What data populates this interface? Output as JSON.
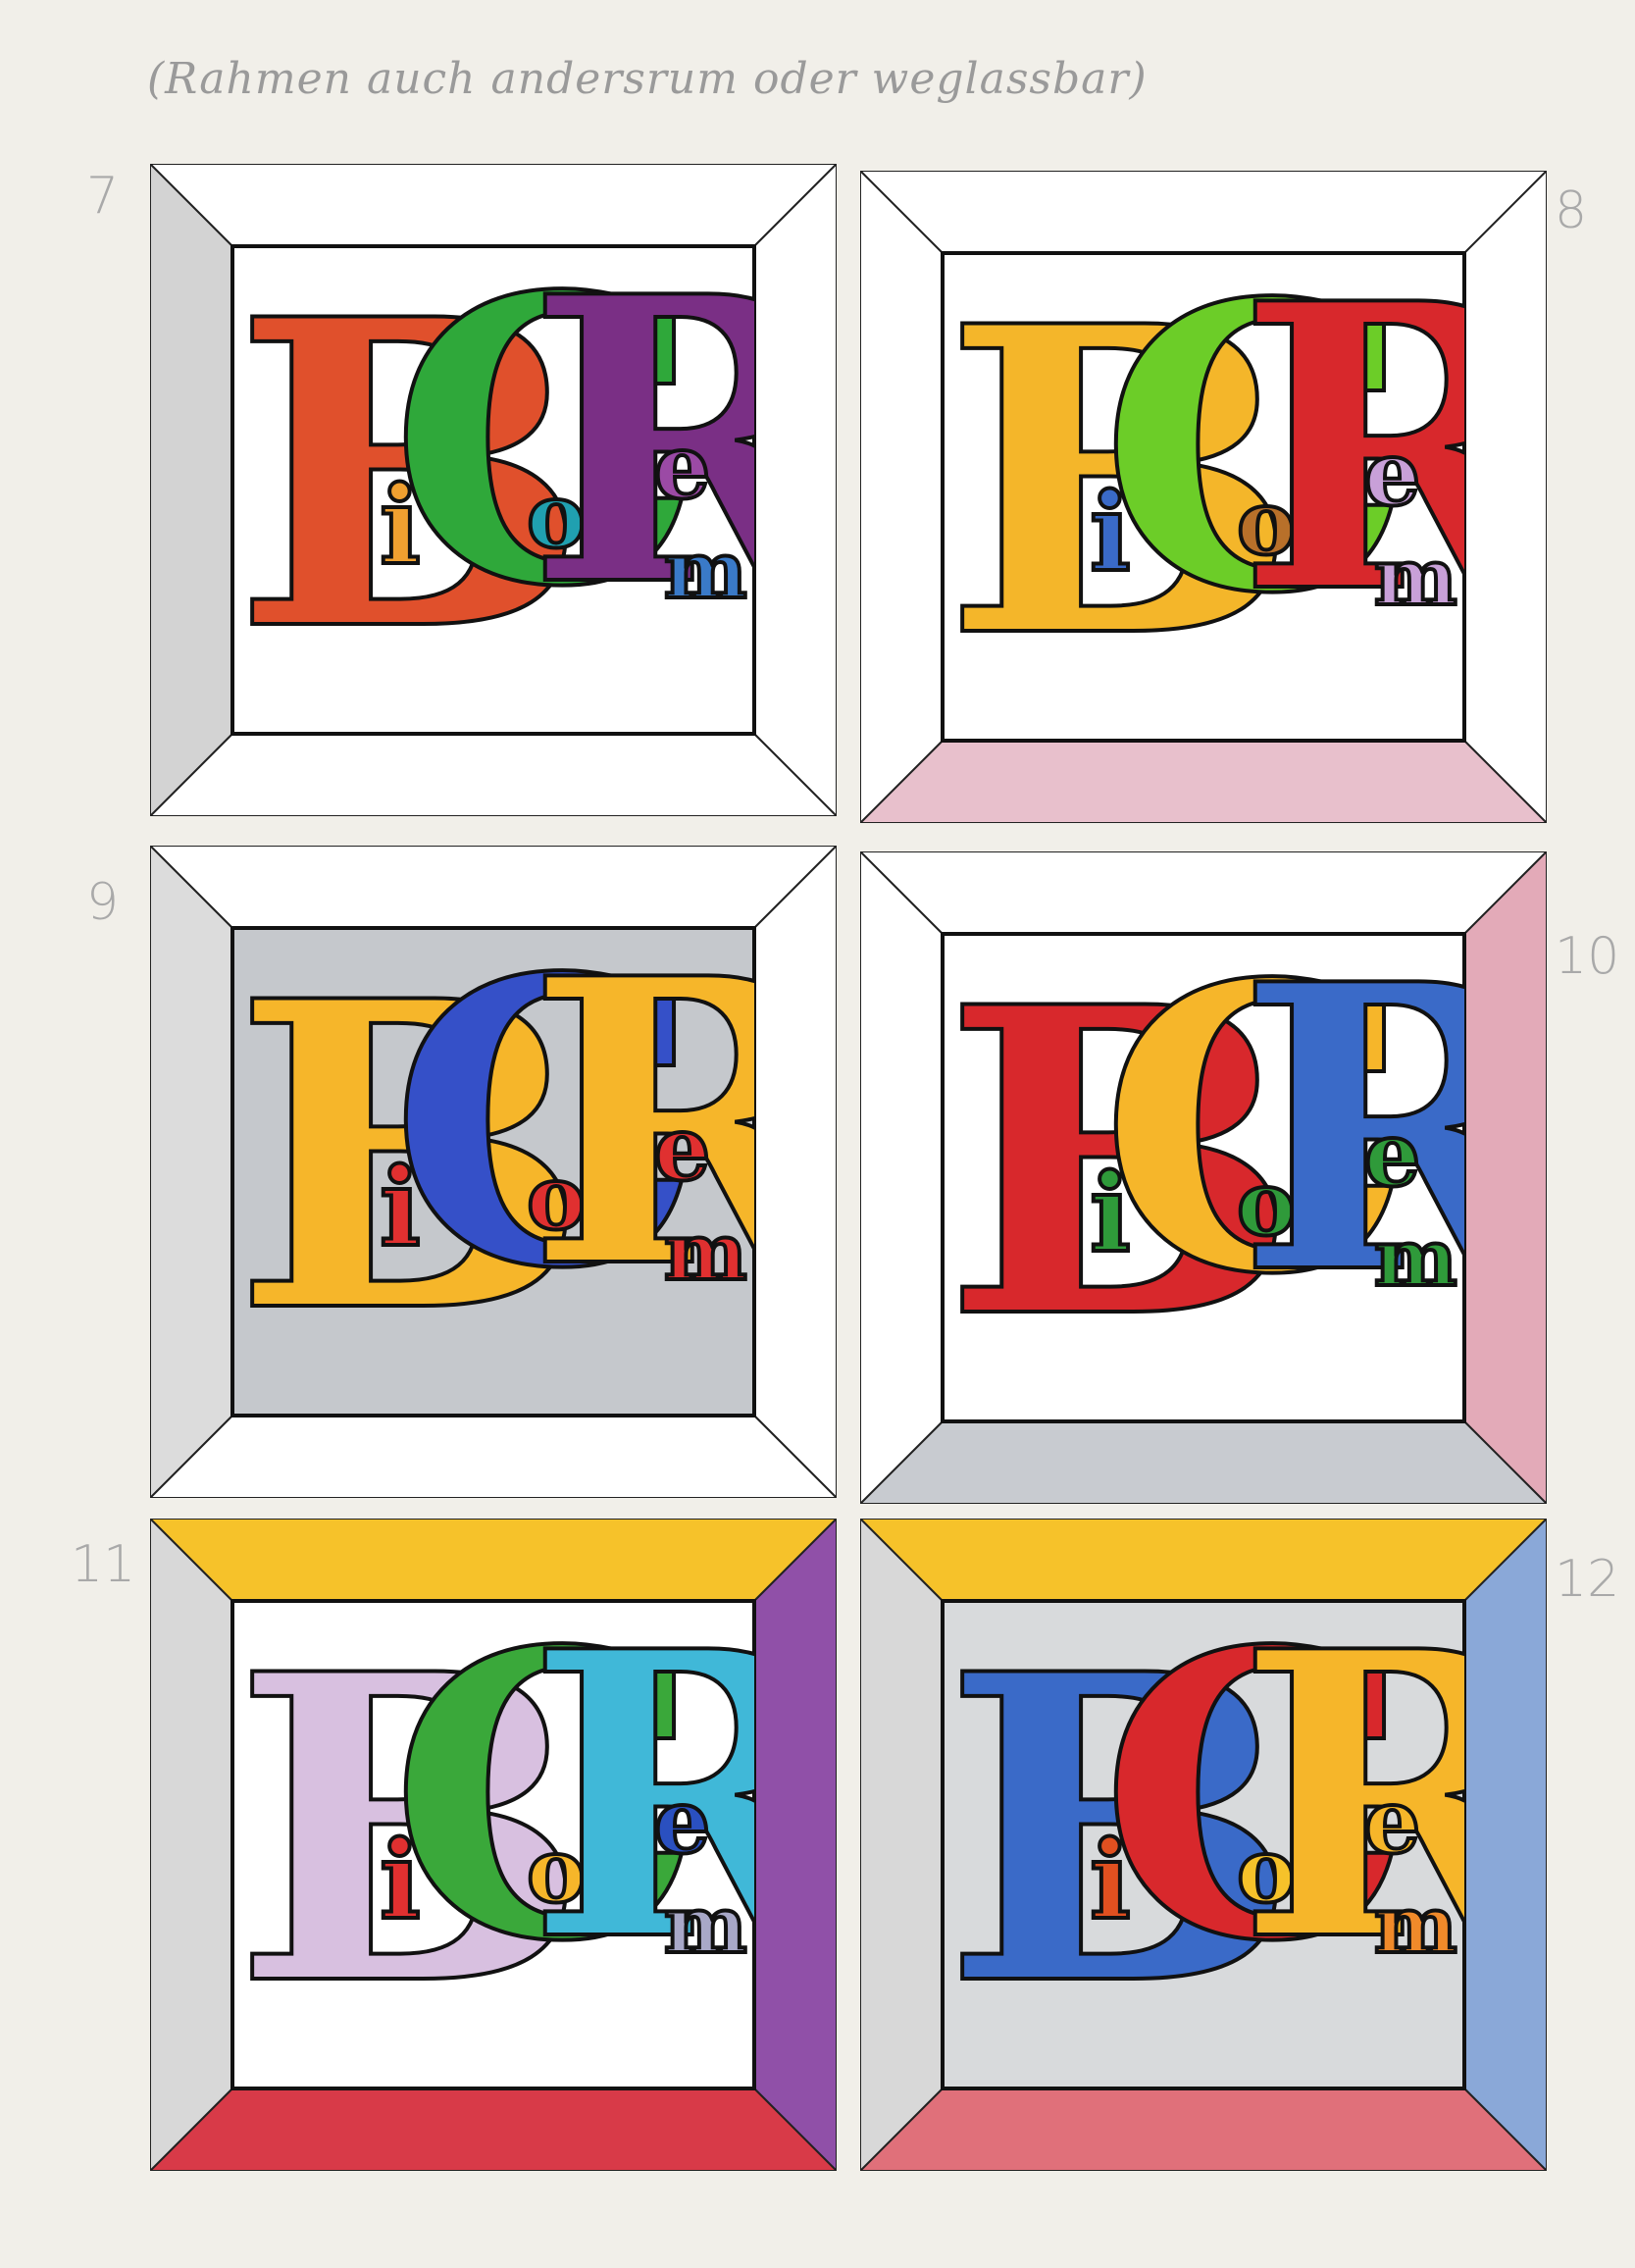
{
  "note": "(Rahmen auch andersrum oder weglassbar)",
  "panels": [
    {
      "number": "7",
      "inner_bg": "#ffffff",
      "bevels": {
        "top": "#ffffff",
        "right": "#ffffff",
        "bottom": "#ffffff",
        "left": "#d3d3d3"
      },
      "letters": [
        {
          "char": "B",
          "color": "#e0502c"
        },
        {
          "char": "i",
          "color": "#f0a030"
        },
        {
          "char": "C",
          "color": "#2fa83a"
        },
        {
          "char": "o",
          "color": "#20a0b0"
        },
        {
          "char": "R",
          "color": "#7a2f85"
        },
        {
          "char": "e",
          "color": "#9b4aa5"
        },
        {
          "char": "m",
          "color": "#3a7ac8"
        }
      ]
    },
    {
      "number": "8",
      "inner_bg": "#ffffff",
      "bevels": {
        "top": "#ffffff",
        "right": "#ffffff",
        "bottom": "#e8c0cc",
        "left": "#ffffff"
      },
      "letters": [
        {
          "char": "B",
          "color": "#f4b62a"
        },
        {
          "char": "i",
          "color": "#3a6ac8"
        },
        {
          "char": "C",
          "color": "#6ccd28"
        },
        {
          "char": "o",
          "color": "#b8702a"
        },
        {
          "char": "R",
          "color": "#d8282c"
        },
        {
          "char": "e",
          "color": "#c8a0d8"
        },
        {
          "char": "m",
          "color": "#c8a0d8"
        }
      ]
    },
    {
      "number": "9",
      "inner_bg": "#c5c8cc",
      "bevels": {
        "top": "#ffffff",
        "right": "#ffffff",
        "bottom": "#ffffff",
        "left": "#dcdcdc"
      },
      "letters": [
        {
          "char": "B",
          "color": "#f6b62a"
        },
        {
          "char": "i",
          "color": "#e03030"
        },
        {
          "char": "C",
          "color": "#3550c8"
        },
        {
          "char": "o",
          "color": "#e03030"
        },
        {
          "char": "R",
          "color": "#f6b62a"
        },
        {
          "char": "e",
          "color": "#e03030"
        },
        {
          "char": "m",
          "color": "#e03030"
        }
      ]
    },
    {
      "number": "10",
      "inner_bg": "#ffffff",
      "bevels": {
        "top": "#ffffff",
        "right": "#e3aab8",
        "bottom": "#c8cbd0",
        "left": "#ffffff"
      },
      "letters": [
        {
          "char": "B",
          "color": "#d8282c"
        },
        {
          "char": "i",
          "color": "#2f9a3a"
        },
        {
          "char": "C",
          "color": "#f6b62a"
        },
        {
          "char": "o",
          "color": "#2f9a3a"
        },
        {
          "char": "R",
          "color": "#3a6ac8"
        },
        {
          "char": "e",
          "color": "#2f9a3a"
        },
        {
          "char": "m",
          "color": "#2f9a3a"
        }
      ]
    },
    {
      "number": "11",
      "inner_bg": "#ffffff",
      "bevels": {
        "top": "#f6c22a",
        "right": "#9050a8",
        "bottom": "#d83a48",
        "left": "#d8d8d8"
      },
      "letters": [
        {
          "char": "B",
          "color": "#d8c0e0"
        },
        {
          "char": "i",
          "color": "#e03030"
        },
        {
          "char": "C",
          "color": "#3aa83a"
        },
        {
          "char": "o",
          "color": "#f6b62a"
        },
        {
          "char": "R",
          "color": "#40b8d8"
        },
        {
          "char": "e",
          "color": "#2a50c0"
        },
        {
          "char": "m",
          "color": "#a8a8c8"
        }
      ]
    },
    {
      "number": "12",
      "inner_bg": "#d8dadc",
      "bevels": {
        "top": "#f6c22a",
        "right": "#8aa8d8",
        "bottom": "#e0707a",
        "left": "#d8d8d8"
      },
      "letters": [
        {
          "char": "B",
          "color": "#3a6ac8"
        },
        {
          "char": "i",
          "color": "#e05020"
        },
        {
          "char": "C",
          "color": "#d8282c"
        },
        {
          "char": "o",
          "color": "#f6c22a"
        },
        {
          "char": "R",
          "color": "#f6b62a"
        },
        {
          "char": "e",
          "color": "#f6b62a"
        },
        {
          "char": "m",
          "color": "#f08a2a"
        }
      ]
    }
  ]
}
